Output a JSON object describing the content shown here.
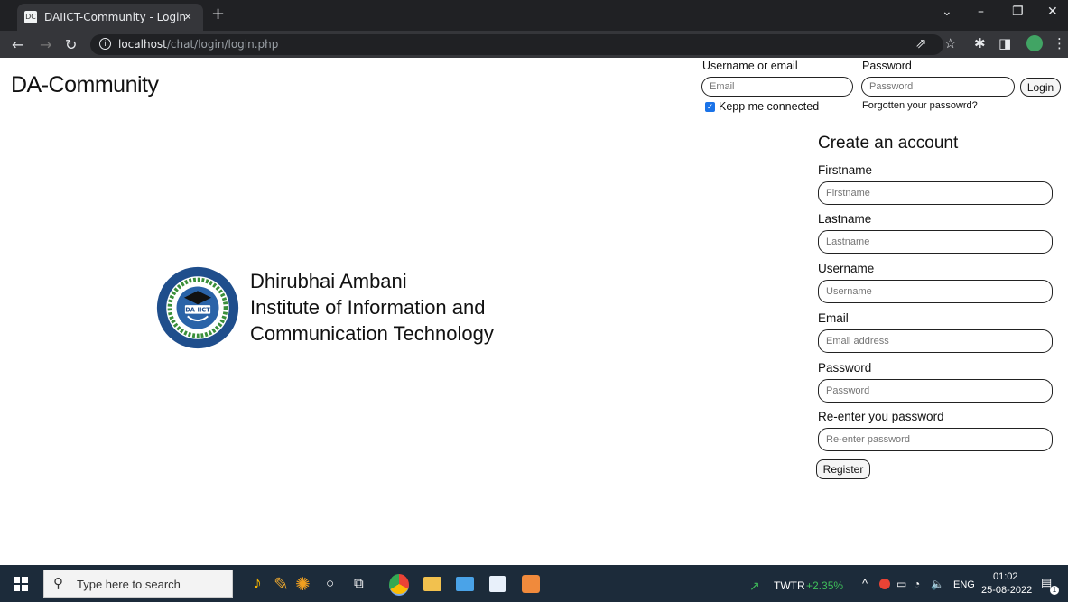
{
  "browser": {
    "tab_title": "DAIICT-Community - Login",
    "tab_close": "×",
    "new_tab": "+",
    "favicon_text": "DC",
    "url_host": "localhost",
    "url_path": "/chat/login/login.php",
    "window_controls": [
      "⌄",
      "–",
      "❐",
      "✕"
    ]
  },
  "header": {
    "brand": "DA-Community",
    "login": {
      "username_label": "Username or email",
      "username_placeholder": "Email",
      "password_label": "Password",
      "password_placeholder": "Password",
      "login_button": "Login",
      "keep_connected": "Kepp me connected",
      "forgot_password": "Forgotten your passowrd?"
    }
  },
  "institute": {
    "line1": "Dhirubhai Ambani",
    "line2": "Institute of Information and",
    "line3": "Communication Technology",
    "logo_text": "DA-IICT"
  },
  "register": {
    "title": "Create an account",
    "fields": [
      {
        "label": "Firstname",
        "placeholder": "Firstname"
      },
      {
        "label": "Lastname",
        "placeholder": "Lastname"
      },
      {
        "label": "Username",
        "placeholder": "Username"
      },
      {
        "label": "Email",
        "placeholder": "Email address"
      },
      {
        "label": "Password",
        "placeholder": "Password"
      },
      {
        "label": "Re-enter you password",
        "placeholder": "Re-enter password"
      }
    ],
    "register_button": "Register"
  },
  "taskbar": {
    "search_placeholder": "Type here to search",
    "stock_ticker": "TWTR",
    "stock_change": "+2.35%",
    "language": "ENG",
    "time": "01:02",
    "date": "25-08-2022",
    "notification_count": "1"
  },
  "colors": {
    "chrome_dark": "#202124",
    "chrome_toolbar": "#35363a",
    "checkbox_blue": "#1a73e8",
    "taskbar": "#1c2b3a",
    "stock_green": "#3fbf5a"
  }
}
